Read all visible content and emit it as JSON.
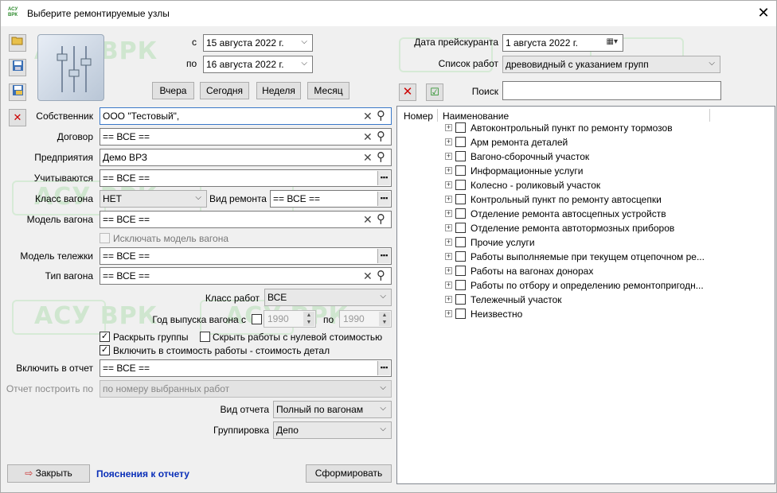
{
  "window": {
    "title": "Выберите ремонтируемые узлы",
    "logo": "АСУ ВРК",
    "close": "✕"
  },
  "watermark": "АСУ ВРК",
  "toolbar": {
    "open_icon": "folder-open-icon",
    "save_icon": "save-icon",
    "saveas_icon": "save-as-icon",
    "delete_icon": "delete-icon"
  },
  "dates": {
    "from_label": "с",
    "from_value": "15  августа  2022 г.",
    "to_label": "по",
    "to_value": "16  августа  2022 г."
  },
  "quick": {
    "yesterday": "Вчера",
    "today": "Сегодня",
    "week": "Неделя",
    "month": "Месяц"
  },
  "pricelist": {
    "label": "Дата прейскуранта",
    "value": "1  августа  2022 г."
  },
  "worklist": {
    "label": "Список работ",
    "value": "древовидный с указанием групп"
  },
  "search": {
    "label": "Поиск",
    "value": ""
  },
  "fields": {
    "owner": {
      "label": "Собственник",
      "value": "ООО \"Тестовый\","
    },
    "contract": {
      "label": "Договор",
      "value": "== ВСЕ =="
    },
    "enterprise": {
      "label": "Предприятия",
      "value": "Демо ВРЗ"
    },
    "accounted": {
      "label": "Учитываются",
      "value": "== ВСЕ =="
    },
    "wagon_class": {
      "label": "Класс вагона",
      "value": "НЕТ"
    },
    "repair_type": {
      "label": "Вид ремонта",
      "value": "== ВСЕ =="
    },
    "wagon_model": {
      "label": "Модель вагона",
      "value": "== ВСЕ =="
    },
    "exclude_model": {
      "label": "Исключать модель вагона"
    },
    "bogie_model": {
      "label": "Модель тележки",
      "value": "== ВСЕ =="
    },
    "wagon_type": {
      "label": "Тип вагона",
      "value": "== ВСЕ =="
    },
    "work_class": {
      "label": "Класс работ",
      "value": "ВСЕ"
    },
    "year": {
      "label": "Год выпуска вагона с",
      "from": "1990",
      "to_label": "по",
      "to": "1990"
    },
    "expand_groups": {
      "label": "Раскрыть группы",
      "checked": "✓"
    },
    "hide_zero": {
      "label": "Скрыть работы с нулевой стоимостью"
    },
    "include_cost": {
      "label": "Включить в стоимость работы - стоимость детал",
      "checked": "✓"
    },
    "include_report": {
      "label": "Включить в отчет",
      "value": "== ВСЕ =="
    },
    "build_by": {
      "label": "Отчет построить по",
      "value": "по номеру выбранных работ"
    },
    "report_type": {
      "label": "Вид отчета",
      "value": "Полный по вагонам"
    },
    "grouping": {
      "label": "Группировка",
      "value": "Депо"
    }
  },
  "buttons": {
    "close": "Закрыть",
    "notes": "Пояснения к отчету",
    "build": "Сформировать"
  },
  "tree": {
    "col_number": "Номер",
    "col_name": "Наименование",
    "items": [
      "Автоконтрольный пункт по ремонту тормозов",
      "Арм ремонта деталей",
      "Вагоно-сборочный участок",
      "Информационные услуги",
      "Колесно - роликовый участок",
      "Контрольный пункт по ремонту автосцепки",
      "Отделение ремонта автосцепных устройств",
      "Отделение ремонта автотормозных приборов",
      "Прочие услуги",
      "Работы выполняемые при текущем отцепочном ре...",
      "Работы на вагонах донорах",
      "Работы по отбору и определению ремонтопригодн...",
      "Тележечный участок",
      "Неизвестно"
    ]
  }
}
